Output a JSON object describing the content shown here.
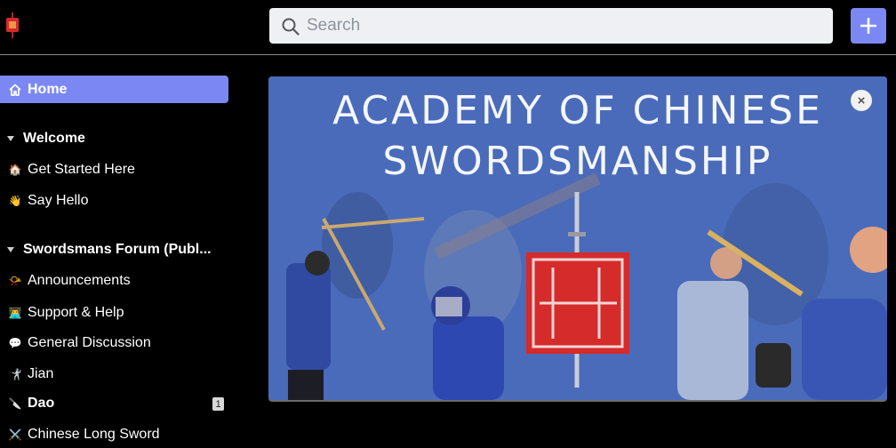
{
  "header": {
    "logo_icon": "red-lantern-logo",
    "search": {
      "placeholder": "Search",
      "value": ""
    },
    "add_button": "+"
  },
  "sidebar": {
    "home": "Home",
    "sections": [
      {
        "title": "Welcome",
        "items": [
          {
            "label": "Get Started Here",
            "icon": "🏠"
          },
          {
            "label": "Say Hello",
            "icon": "👋"
          }
        ]
      },
      {
        "title": "Swordsmans Forum (Publ...",
        "items": [
          {
            "label": "Announcements",
            "icon": "📯"
          },
          {
            "label": "Support & Help",
            "icon": "👨‍💻"
          },
          {
            "label": "General Discussion",
            "icon": "💬"
          },
          {
            "label": "Jian",
            "icon": "🤺"
          },
          {
            "label": "Dao",
            "icon": "🔪",
            "badge": "1"
          },
          {
            "label": "Chinese Long Sword",
            "icon": "⚔️"
          }
        ]
      }
    ]
  },
  "banner": {
    "title_line1": "ACADEMY OF CHINESE",
    "title_line2": "SWORDSMANSHIP",
    "close": "×",
    "colors": {
      "overlay": "#4a69b6",
      "seal": "#d52b2b"
    }
  }
}
